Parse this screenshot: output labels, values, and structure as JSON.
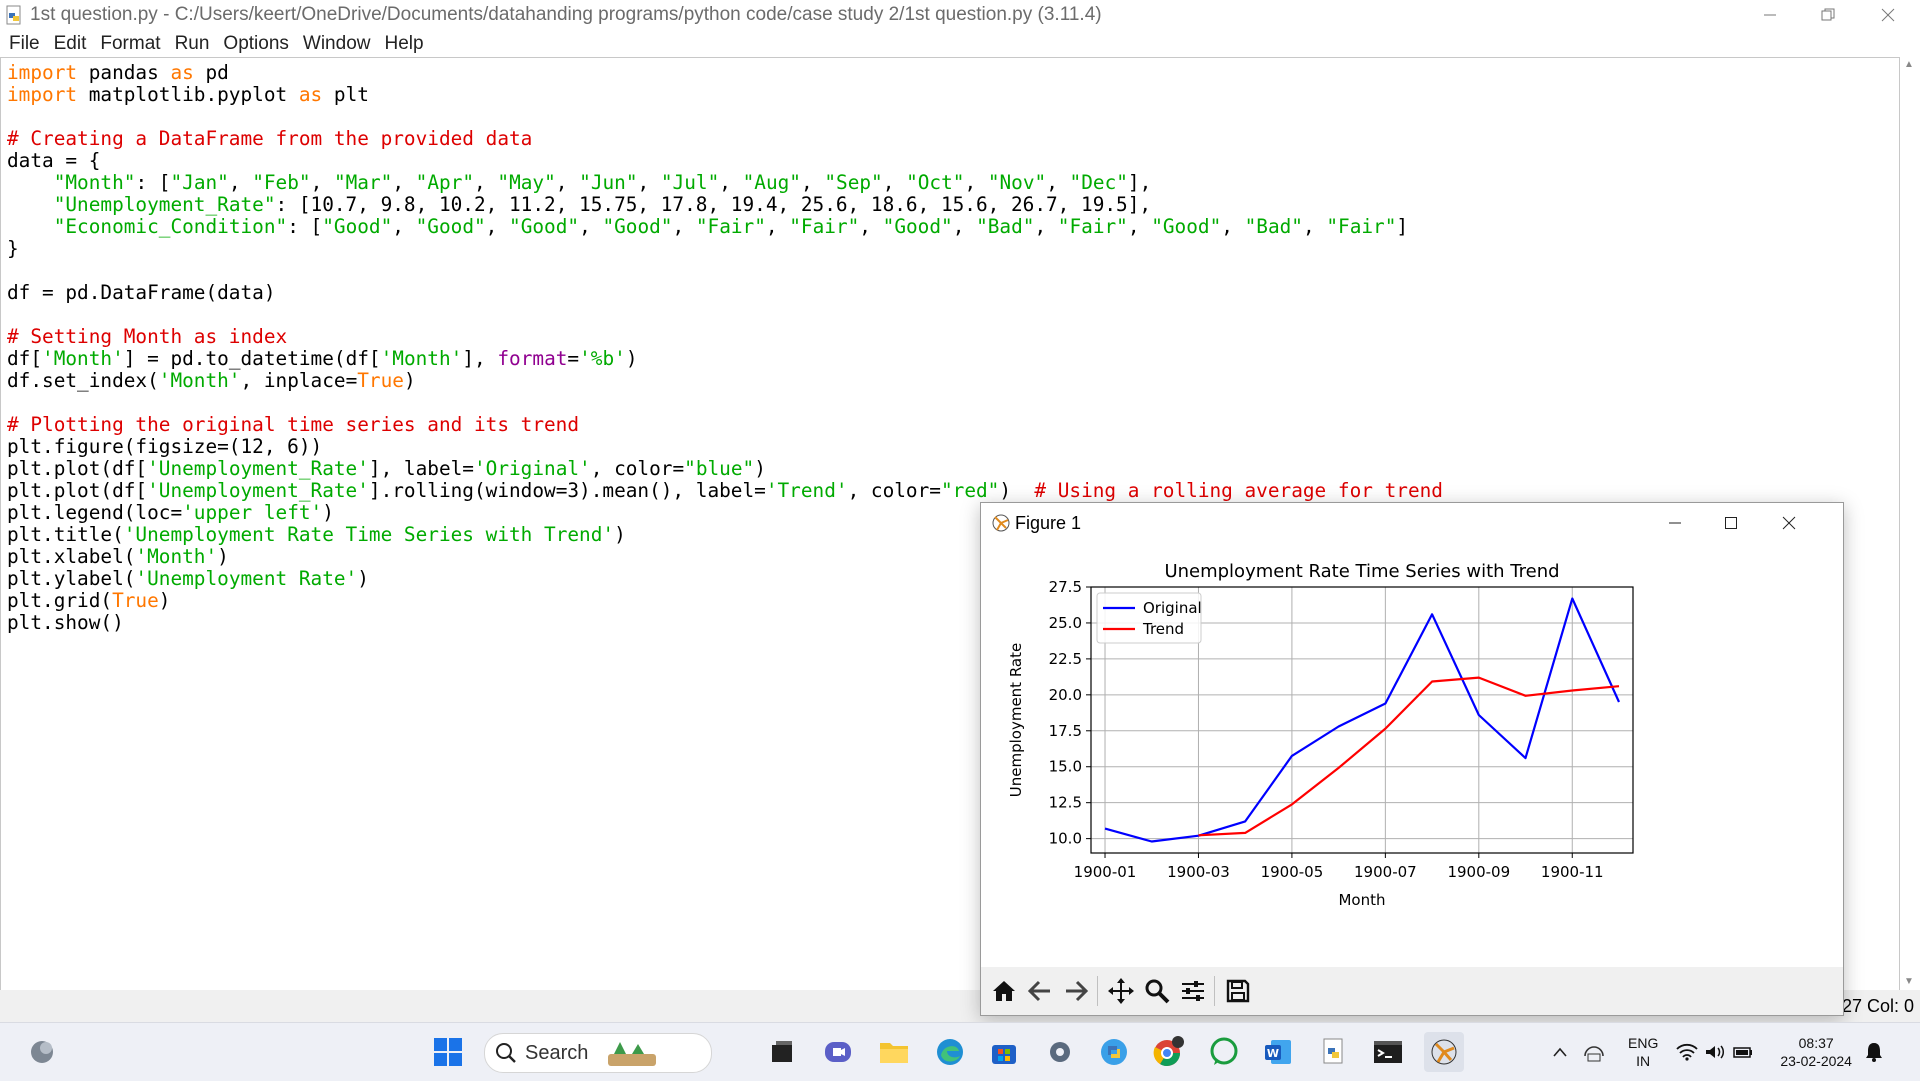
{
  "window": {
    "title": "1st question.py - C:/Users/keert/OneDrive/Documents/datahanding programs/python code/case study 2/1st question.py (3.11.4)"
  },
  "menu": [
    "File",
    "Edit",
    "Format",
    "Run",
    "Options",
    "Window",
    "Help"
  ],
  "code_lines": [
    [
      {
        "t": "import",
        "c": "kw"
      },
      {
        "t": " pandas "
      },
      {
        "t": "as",
        "c": "kw"
      },
      {
        "t": " pd"
      }
    ],
    [
      {
        "t": "import",
        "c": "kw"
      },
      {
        "t": " matplotlib.pyplot "
      },
      {
        "t": "as",
        "c": "kw"
      },
      {
        "t": " plt"
      }
    ],
    [],
    [
      {
        "t": "# Creating a DataFrame from the provided data",
        "c": "cm"
      }
    ],
    [
      {
        "t": "data = {"
      }
    ],
    [
      {
        "t": "    "
      },
      {
        "t": "\"Month\"",
        "c": "st"
      },
      {
        "t": ": ["
      },
      {
        "t": "\"Jan\"",
        "c": "st"
      },
      {
        "t": ", "
      },
      {
        "t": "\"Feb\"",
        "c": "st"
      },
      {
        "t": ", "
      },
      {
        "t": "\"Mar\"",
        "c": "st"
      },
      {
        "t": ", "
      },
      {
        "t": "\"Apr\"",
        "c": "st"
      },
      {
        "t": ", "
      },
      {
        "t": "\"May\"",
        "c": "st"
      },
      {
        "t": ", "
      },
      {
        "t": "\"Jun\"",
        "c": "st"
      },
      {
        "t": ", "
      },
      {
        "t": "\"Jul\"",
        "c": "st"
      },
      {
        "t": ", "
      },
      {
        "t": "\"Aug\"",
        "c": "st"
      },
      {
        "t": ", "
      },
      {
        "t": "\"Sep\"",
        "c": "st"
      },
      {
        "t": ", "
      },
      {
        "t": "\"Oct\"",
        "c": "st"
      },
      {
        "t": ", "
      },
      {
        "t": "\"Nov\"",
        "c": "st"
      },
      {
        "t": ", "
      },
      {
        "t": "\"Dec\"",
        "c": "st"
      },
      {
        "t": "],"
      }
    ],
    [
      {
        "t": "    "
      },
      {
        "t": "\"Unemployment_Rate\"",
        "c": "st"
      },
      {
        "t": ": [10.7, 9.8, 10.2, 11.2, 15.75, 17.8, 19.4, 25.6, 18.6, 15.6, 26.7, 19.5],"
      }
    ],
    [
      {
        "t": "    "
      },
      {
        "t": "\"Economic_Condition\"",
        "c": "st"
      },
      {
        "t": ": ["
      },
      {
        "t": "\"Good\"",
        "c": "st"
      },
      {
        "t": ", "
      },
      {
        "t": "\"Good\"",
        "c": "st"
      },
      {
        "t": ", "
      },
      {
        "t": "\"Good\"",
        "c": "st"
      },
      {
        "t": ", "
      },
      {
        "t": "\"Good\"",
        "c": "st"
      },
      {
        "t": ", "
      },
      {
        "t": "\"Fair\"",
        "c": "st"
      },
      {
        "t": ", "
      },
      {
        "t": "\"Fair\"",
        "c": "st"
      },
      {
        "t": ", "
      },
      {
        "t": "\"Good\"",
        "c": "st"
      },
      {
        "t": ", "
      },
      {
        "t": "\"Bad\"",
        "c": "st"
      },
      {
        "t": ", "
      },
      {
        "t": "\"Fair\"",
        "c": "st"
      },
      {
        "t": ", "
      },
      {
        "t": "\"Good\"",
        "c": "st"
      },
      {
        "t": ", "
      },
      {
        "t": "\"Bad\"",
        "c": "st"
      },
      {
        "t": ", "
      },
      {
        "t": "\"Fair\"",
        "c": "st"
      },
      {
        "t": "]"
      }
    ],
    [
      {
        "t": "}"
      }
    ],
    [],
    [
      {
        "t": "df = pd.DataFrame(data)"
      }
    ],
    [],
    [
      {
        "t": "# Setting Month as index",
        "c": "cm"
      }
    ],
    [
      {
        "t": "df["
      },
      {
        "t": "'Month'",
        "c": "st"
      },
      {
        "t": "] = pd.to_datetime(df["
      },
      {
        "t": "'Month'",
        "c": "st"
      },
      {
        "t": "], "
      },
      {
        "t": "format",
        "c": "bi"
      },
      {
        "t": "="
      },
      {
        "t": "'%b'",
        "c": "st"
      },
      {
        "t": ")"
      }
    ],
    [
      {
        "t": "df.set_index("
      },
      {
        "t": "'Month'",
        "c": "st"
      },
      {
        "t": ", inplace="
      },
      {
        "t": "True",
        "c": "kw"
      },
      {
        "t": ")"
      }
    ],
    [],
    [
      {
        "t": "# Plotting the original time series and its trend",
        "c": "cm"
      }
    ],
    [
      {
        "t": "plt.figure(figsize=(12, 6))"
      }
    ],
    [
      {
        "t": "plt.plot(df["
      },
      {
        "t": "'Unemployment_Rate'",
        "c": "st"
      },
      {
        "t": "], label="
      },
      {
        "t": "'Original'",
        "c": "st"
      },
      {
        "t": ", color="
      },
      {
        "t": "\"blue\"",
        "c": "st"
      },
      {
        "t": ")"
      }
    ],
    [
      {
        "t": "plt.plot(df["
      },
      {
        "t": "'Unemployment_Rate'",
        "c": "st"
      },
      {
        "t": "].rolling(window=3).mean(), label="
      },
      {
        "t": "'Trend'",
        "c": "st"
      },
      {
        "t": ", color="
      },
      {
        "t": "\"red\"",
        "c": "st"
      },
      {
        "t": ")  "
      },
      {
        "t": "# Using a rolling average for trend",
        "c": "cm"
      }
    ],
    [
      {
        "t": "plt.legend(loc="
      },
      {
        "t": "'upper left'",
        "c": "st"
      },
      {
        "t": ")"
      }
    ],
    [
      {
        "t": "plt.title("
      },
      {
        "t": "'Unemployment Rate Time Series with Trend'",
        "c": "st"
      },
      {
        "t": ")"
      }
    ],
    [
      {
        "t": "plt.xlabel("
      },
      {
        "t": "'Month'",
        "c": "st"
      },
      {
        "t": ")"
      }
    ],
    [
      {
        "t": "plt.ylabel("
      },
      {
        "t": "'Unemployment Rate'",
        "c": "st"
      },
      {
        "t": ")"
      }
    ],
    [
      {
        "t": "plt.grid("
      },
      {
        "t": "True",
        "c": "kw"
      },
      {
        "t": ")"
      }
    ],
    [
      {
        "t": "plt.show()"
      }
    ]
  ],
  "status": {
    "position": "27  Col: 0"
  },
  "figure_window": {
    "title": "Figure 1"
  },
  "chart_data": {
    "type": "line",
    "title": "Unemployment Rate Time Series with Trend",
    "xlabel": "Month",
    "ylabel": "Unemployment Rate",
    "x": [
      "1900-01",
      "1900-02",
      "1900-03",
      "1900-04",
      "1900-05",
      "1900-06",
      "1900-07",
      "1900-08",
      "1900-09",
      "1900-10",
      "1900-11",
      "1900-12"
    ],
    "x_tick_labels": [
      "1900-01",
      "1900-03",
      "1900-05",
      "1900-07",
      "1900-09",
      "1900-11"
    ],
    "y_ticks": [
      "10.0",
      "12.5",
      "15.0",
      "17.5",
      "20.0",
      "22.5",
      "25.0",
      "27.5"
    ],
    "ylim": [
      9.0,
      27.5
    ],
    "grid": true,
    "legend_position": "upper left",
    "series": [
      {
        "name": "Original",
        "color": "#0000ff",
        "values": [
          10.7,
          9.8,
          10.2,
          11.2,
          15.75,
          17.8,
          19.4,
          25.6,
          18.6,
          15.6,
          26.7,
          19.5
        ]
      },
      {
        "name": "Trend",
        "color": "#ff0000",
        "values": [
          null,
          null,
          10.23,
          10.4,
          12.38,
          14.92,
          17.65,
          20.93,
          21.2,
          19.93,
          20.3,
          20.6
        ]
      }
    ]
  },
  "taskbar": {
    "search_label": "Search",
    "lang_line1": "ENG",
    "lang_line2": "IN",
    "time": "08:37",
    "date": "23-02-2024"
  }
}
